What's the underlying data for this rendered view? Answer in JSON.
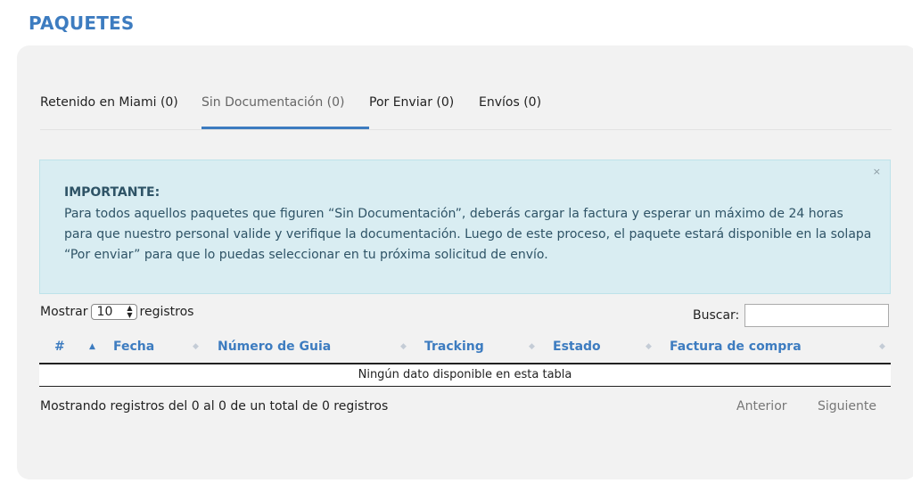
{
  "page": {
    "title": "PAQUETES"
  },
  "tabs": [
    {
      "label": "Retenido en Miami (0)"
    },
    {
      "label": "Sin Documentación (0)"
    },
    {
      "label": "Por Enviar (0)"
    },
    {
      "label": "Envíos (0)"
    }
  ],
  "alert": {
    "close": "×",
    "title": "IMPORTANTE:",
    "body": "Para todos aquellos paquetes que figuren “Sin Documentación”, deberás cargar la factura y esperar un máximo de 24 horas para que nuestro personal valide y verifique la documentación. Luego de este proceso, el paquete estará disponible en la solapa “Por enviar” para que lo puedas seleccionar en tu próxima solicitud de envío."
  },
  "table_controls": {
    "show_label": "Mostrar",
    "show_value": "10",
    "records_label": "registros",
    "search_label": "Buscar:",
    "search_value": ""
  },
  "table": {
    "columns": [
      "#",
      "Fecha",
      "Número de Guia",
      "Tracking",
      "Estado",
      "Factura de compra"
    ],
    "empty_message": "Ningún dato disponible en esta tabla"
  },
  "footer": {
    "info": "Mostrando registros del 0 al 0 de un total de 0 registros",
    "prev": "Anterior",
    "next": "Siguiente"
  },
  "colors": {
    "accent": "#3d7cc0",
    "alert_bg": "#d9edf2",
    "panel_bg": "#f2f2f2"
  }
}
